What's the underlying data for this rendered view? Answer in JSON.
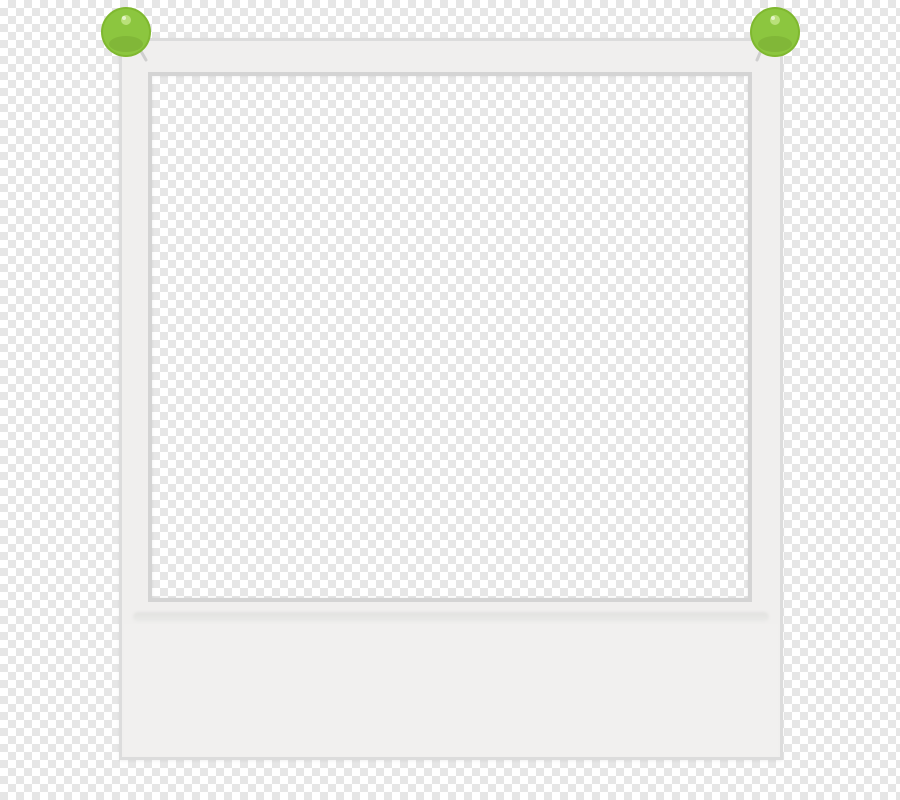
{
  "scene": {
    "description_label": "",
    "colors": {
      "frame": "#f0efee",
      "frame_border": "#dcdcdc",
      "photo_border": "#d4d4d4",
      "pin_green": "#8cc63f",
      "pin_highlight": "#b9e07a",
      "checker_light": "#ffffff",
      "checker_dark": "#e6e6e6"
    },
    "pins": [
      {
        "icon": "pushpin-icon",
        "position": "top-left"
      },
      {
        "icon": "pushpin-icon",
        "position": "top-right"
      }
    ],
    "caption": {
      "text": ""
    }
  }
}
